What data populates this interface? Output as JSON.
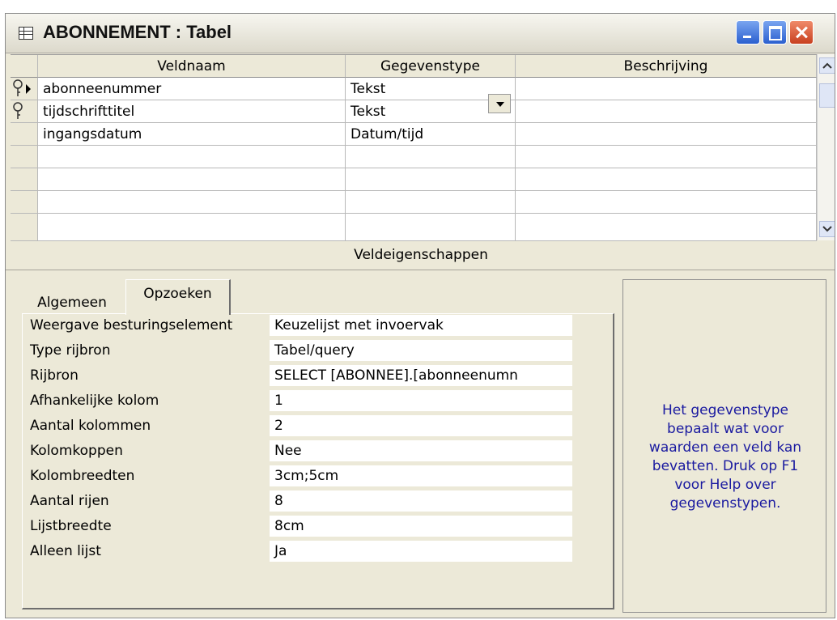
{
  "window": {
    "title": "ABONNEMENT : Tabel"
  },
  "grid": {
    "headers": [
      "Veldnaam",
      "Gegevenstype",
      "Beschrijving"
    ],
    "rows": [
      {
        "name": "abonneenummer",
        "type": "Tekst",
        "description": ""
      },
      {
        "name": "tijdschrifttitel",
        "type": "Tekst",
        "description": ""
      },
      {
        "name": "ingangsdatum",
        "type": "Datum/tijd",
        "description": ""
      },
      {
        "name": "",
        "type": "",
        "description": ""
      },
      {
        "name": "",
        "type": "",
        "description": ""
      },
      {
        "name": "",
        "type": "",
        "description": ""
      },
      {
        "name": "",
        "type": "",
        "description": ""
      }
    ]
  },
  "field_properties": {
    "heading": "Veldeigenschappen",
    "tabs": [
      "Algemeen",
      "Opzoeken"
    ],
    "active_tab": "Opzoeken",
    "properties": [
      {
        "label": "Weergave besturingselement",
        "value": "Keuzelijst met invoervak"
      },
      {
        "label": "Type rijbron",
        "value": "Tabel/query"
      },
      {
        "label": "Rijbron",
        "value": "SELECT [ABONNEE].[abonneenumn"
      },
      {
        "label": "Afhankelijke kolom",
        "value": "1"
      },
      {
        "label": "Aantal kolommen",
        "value": "2"
      },
      {
        "label": "Kolomkoppen",
        "value": "Nee"
      },
      {
        "label": "Kolombreedten",
        "value": "3cm;5cm"
      },
      {
        "label": "Aantal rijen",
        "value": "8"
      },
      {
        "label": "Lijstbreedte",
        "value": "8cm"
      },
      {
        "label": "Alleen lijst",
        "value": "Ja"
      }
    ],
    "help_text": "Het gegevenstype bepaalt wat voor waarden een veld kan bevatten. Druk op F1 voor Help over gegevenstypen."
  },
  "icons": [
    "table-icon",
    "primary-key-icon",
    "row-pointer-icon",
    "dropdown-arrow-icon",
    "scroll-up-icon",
    "scroll-down-icon",
    "minimize-icon",
    "maximize-icon",
    "close-icon"
  ],
  "colors": {
    "help_text": "#1a1aa0",
    "window_bg": "#ece9d8",
    "close_button": "#c8401f"
  }
}
